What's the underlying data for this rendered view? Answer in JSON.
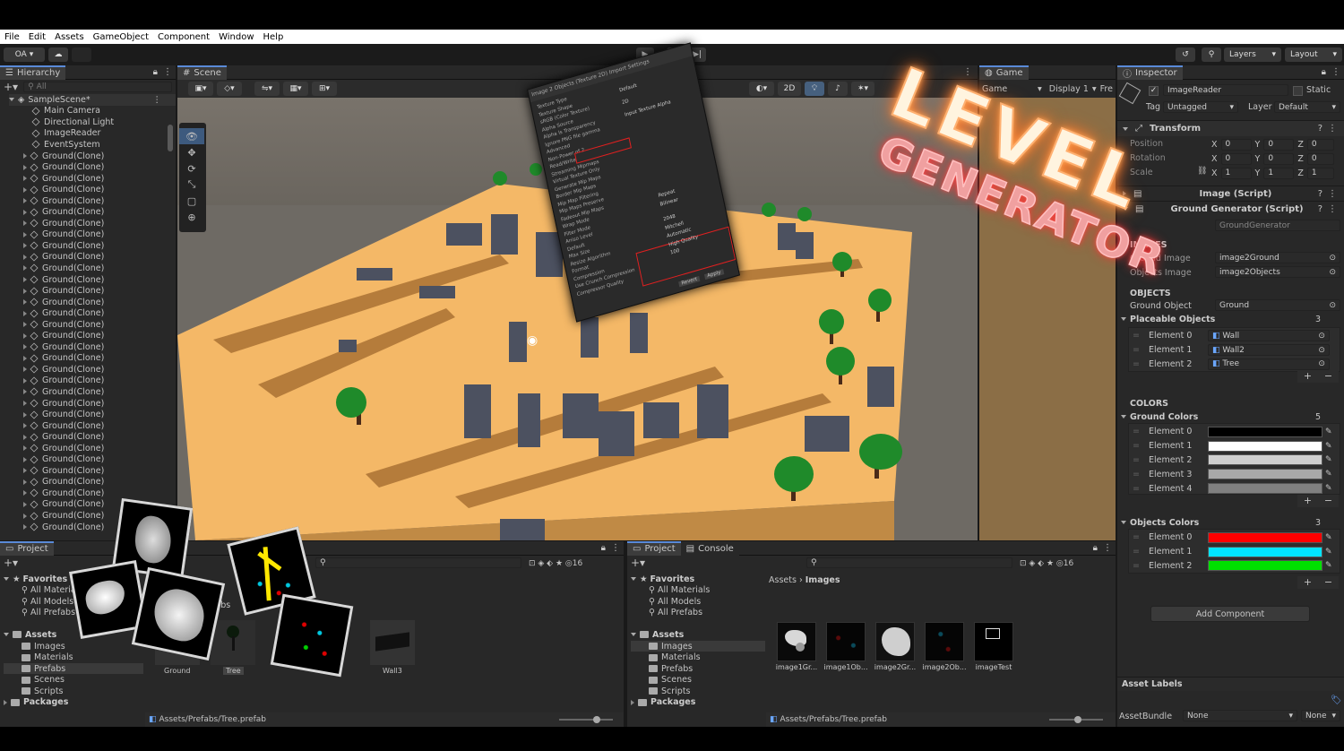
{
  "menu": [
    "File",
    "Edit",
    "Assets",
    "GameObject",
    "Component",
    "Window",
    "Help"
  ],
  "toolbar": {
    "account": "OA",
    "layers": "Layers",
    "layout": "Layout"
  },
  "hierarchy": {
    "tab": "Hierarchy",
    "search_placeholder": "All",
    "scene": "SampleScene*",
    "items": [
      "Main Camera",
      "Directional Light",
      "ImageReader",
      "EventSystem"
    ],
    "clone_label": "Ground(Clone)"
  },
  "scene": {
    "tab": "Scene",
    "mode_2d": "2D"
  },
  "game": {
    "tab": "Game",
    "view": "Game",
    "display": "Display 1",
    "free": "Fre"
  },
  "inspector": {
    "tab": "Inspector",
    "object_name": "ImageReader",
    "static": "Static",
    "tag_label": "Tag",
    "tag_value": "Untagged",
    "layer_label": "Layer",
    "layer_value": "Default",
    "transform": "Transform",
    "position": "Position",
    "rotation": "Rotation",
    "scale": "Scale",
    "pos": [
      "0",
      "0",
      "0"
    ],
    "rot": [
      "0",
      "0",
      "0"
    ],
    "scl": [
      "1",
      "1",
      "1"
    ],
    "image_script": "Image (Script)",
    "ground_script": "Ground Generator (Script)",
    "script_ref": "GroundGenerator",
    "images_header": "IMAGES",
    "ground_image_label": "Ground Image",
    "ground_image": "image2Ground",
    "objects_image_label": "Objects Image",
    "objects_image": "image2Objects",
    "objects_header": "OBJECTS",
    "ground_object_label": "Ground Object",
    "ground_object": "Ground",
    "placeable_label": "Placeable Objects",
    "placeable_count": "3",
    "placeable": [
      {
        "label": "Element 0",
        "value": "Wall"
      },
      {
        "label": "Element 1",
        "value": "Wall2"
      },
      {
        "label": "Element 2",
        "value": "Tree"
      }
    ],
    "colors_header": "COLORS",
    "ground_colors_label": "Ground Colors",
    "ground_colors_count": "5",
    "ground_colors": [
      {
        "label": "Element 0",
        "color": "#000000"
      },
      {
        "label": "Element 1",
        "color": "#ffffff"
      },
      {
        "label": "Element 2",
        "color": "#cfcfcf"
      },
      {
        "label": "Element 3",
        "color": "#a8a8a8"
      },
      {
        "label": "Element 4",
        "color": "#808080"
      }
    ],
    "objects_colors_label": "Objects Colors",
    "objects_colors_count": "3",
    "objects_colors": [
      {
        "label": "Element 0",
        "color": "#ff0000"
      },
      {
        "label": "Element 1",
        "color": "#00e5ff"
      },
      {
        "label": "Element 2",
        "color": "#00e000"
      }
    ],
    "add_component": "Add Component",
    "asset_labels": "Asset Labels",
    "asset_bundle_label": "AssetBundle",
    "asset_bundle": "None",
    "asset_variant": "None"
  },
  "project_left": {
    "tab": "Project",
    "favorites": "Favorites",
    "fav_items": [
      "All Materials",
      "All Models",
      "All Prefabs"
    ],
    "assets": "Assets",
    "folders": [
      "Images",
      "Materials",
      "Prefabs",
      "Scenes",
      "Scripts"
    ],
    "packages": "Packages",
    "breadcrumb": "Prefabs",
    "thumbs": [
      "Ground",
      "Tree",
      "Wall3"
    ],
    "status": "Assets/Prefabs/Tree.prefab",
    "count": "16"
  },
  "project_right": {
    "tabs": [
      "Project",
      "Console"
    ],
    "favorites": "Favorites",
    "fav_items": [
      "All Materials",
      "All Models",
      "All Prefabs"
    ],
    "assets": "Assets",
    "folders": [
      "Images",
      "Materials",
      "Prefabs",
      "Scenes",
      "Scripts"
    ],
    "packages": "Packages",
    "breadcrumb_root": "Assets",
    "breadcrumb_leaf": "Images",
    "thumbs": [
      "image1Gr...",
      "image1Ob...",
      "image2Gr...",
      "image2Ob...",
      "imageTest"
    ],
    "status": "Assets/Prefabs/Tree.prefab",
    "count": "16"
  },
  "overlay_title": {
    "line1": "LEVEL",
    "line2": "GENERATOR"
  },
  "import_panel": {
    "title": "Image 2 Objects (Texture 2D) Import Settings",
    "lines": [
      "Texture Type",
      "Texture Shape",
      "sRGB (Color Texture)",
      "Alpha Source",
      "Alpha Is Transparency",
      "Ignore PNG file gamma",
      "Advanced",
      "Non-Power of 2",
      "Read/Write",
      "Streaming Mipmaps",
      "Virtual Texture Only",
      "Generate Mip Maps",
      "Border Mip Maps",
      "Mip Map Filtering",
      "Mip Maps Preserve",
      "Fadeout Mip Maps",
      "Wrap Mode",
      "Filter Mode",
      "Aniso Level",
      "Default",
      "Max Size",
      "Resize Algorithm",
      "Format",
      "Compression",
      "Use Crunch Compression",
      "Compressor Quality"
    ],
    "values": [
      "Default",
      "2D",
      "Input Texture Alpha",
      "Repeat",
      "Bilinear",
      "2048",
      "Mitchell",
      "Automatic",
      "High Quality",
      "100",
      "Revert",
      "Apply"
    ]
  }
}
